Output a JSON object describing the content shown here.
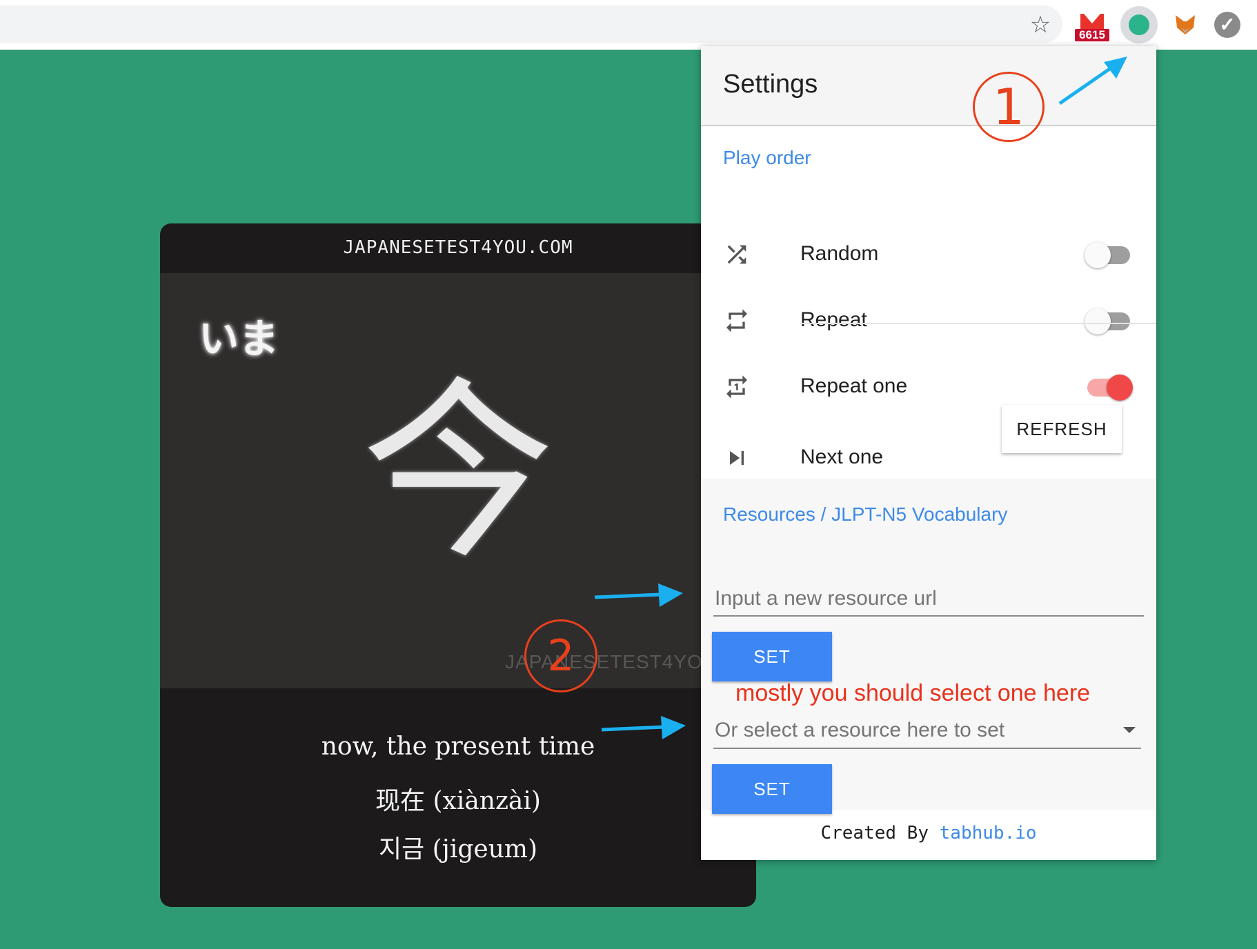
{
  "browser": {
    "gmail_badge_count": "6615"
  },
  "card": {
    "site": "JAPANESETEST4YOU.COM",
    "kana": "いま",
    "kanji": "今",
    "watermark": "JAPANESETEST4YOU.",
    "meaning": "now, the present time",
    "chinese": "现在 (xiànzài)",
    "korean": "지금 (jigeum)"
  },
  "settings": {
    "title": "Settings",
    "play_order_title": "Play order",
    "rows": [
      {
        "label": "Random",
        "icon": "shuffle-icon",
        "toggle": false
      },
      {
        "label": "Repeat",
        "icon": "repeat-icon",
        "toggle": false
      },
      {
        "label": "Repeat one",
        "icon": "repeat-one-icon",
        "toggle": true
      },
      {
        "label": "Next one",
        "icon": "skip-next-icon"
      }
    ],
    "refresh_label": "REFRESH",
    "resources_title": "Resources / JLPT-N5 Vocabulary",
    "url_placeholder": "Input a new resource url",
    "set_label": "SET",
    "select_placeholder": "Or select a resource here to set",
    "footer_prefix": "Created By",
    "footer_link": "tabhub.io"
  },
  "annotations": {
    "hint": "mostly you should select one here",
    "step1": "1",
    "step2": "2"
  },
  "colors": {
    "page_bg": "#2e9b74",
    "accent_blue": "#3d87f5",
    "toggle_on": "#f04848",
    "annotation_red": "#e8321c",
    "arrow_cyan": "#1ab0ef"
  }
}
